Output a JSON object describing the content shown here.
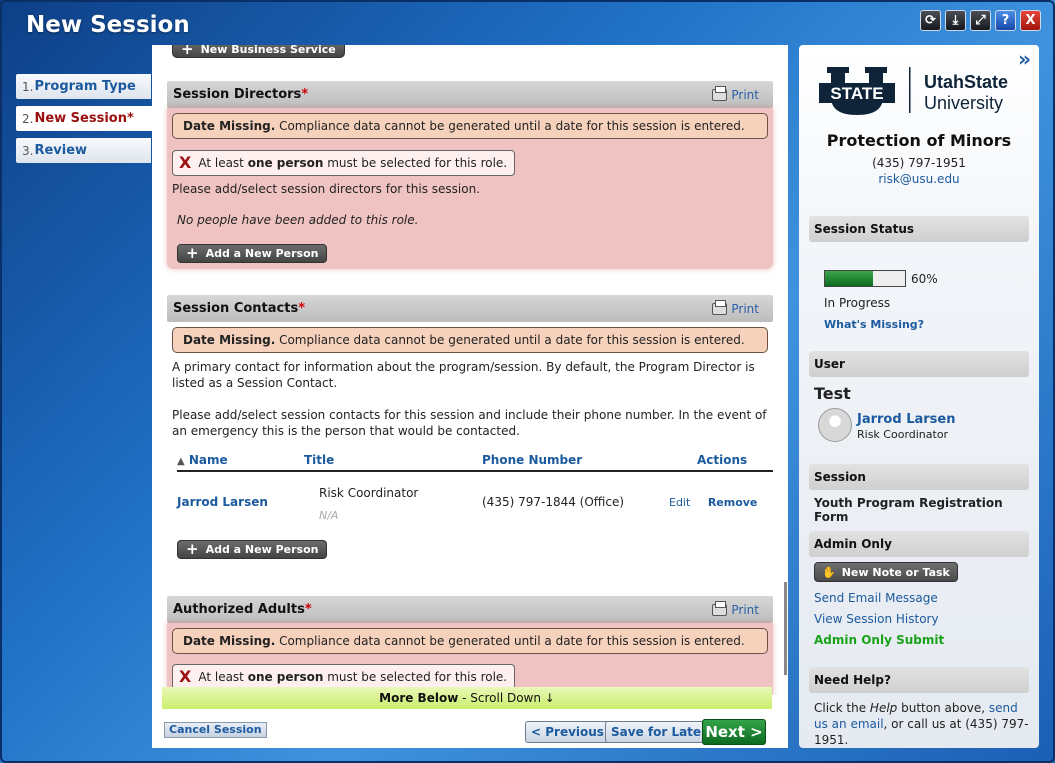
{
  "app": {
    "title": "New Session"
  },
  "window_controls": [
    {
      "name": "refresh-icon",
      "glyph": "⟳"
    },
    {
      "name": "download-icon",
      "glyph": "⤓"
    },
    {
      "name": "expand-icon",
      "glyph": "⤢"
    },
    {
      "name": "help-icon",
      "glyph": "?"
    },
    {
      "name": "close-icon",
      "glyph": "X"
    }
  ],
  "steps": [
    {
      "num": "1.",
      "label": "Program Type"
    },
    {
      "num": "2.",
      "label": "New Session*"
    },
    {
      "num": "3.",
      "label": "Review"
    }
  ],
  "top_button": "New Business Service",
  "date_missing": {
    "bold": "Date Missing.",
    "text": " Compliance data cannot be generated until a date for this session is entered."
  },
  "error": {
    "pre": "At least ",
    "bold": "one person",
    "post": " must be selected for this role."
  },
  "print_label": "Print",
  "add_person_label": "Add a New Person",
  "directors": {
    "title": "Session Directors",
    "req": "*",
    "instruction": "Please add/select session directors for this session.",
    "empty": "No people have been added to this role."
  },
  "contacts": {
    "title": "Session Contacts",
    "req": "*",
    "desc1": "A primary contact for information about the program/session.  By default, the Program Director is listed as a Session Contact.",
    "desc2": "Please add/select session contacts for this session and include their phone number. In the event of an emergency this is the person that would be contacted.",
    "columns": {
      "name": "Name",
      "title": "Title",
      "phone": "Phone Number",
      "actions": "Actions"
    },
    "rows": [
      {
        "name": "Jarrod Larsen",
        "title": "Risk Coordinator",
        "title2": "N/A",
        "phone": "(435) 797-1844 (Office)",
        "edit": "Edit",
        "remove": "Remove"
      }
    ]
  },
  "adults": {
    "title": "Authorized Adults",
    "req": "*"
  },
  "more_below": {
    "bold": "More Below",
    "text": " - Scroll Down ↓"
  },
  "footer": {
    "cancel": "Cancel Session",
    "previous": "< Previous",
    "save": "Save for Later",
    "next": "Next >"
  },
  "sidebar": {
    "collapse": "»",
    "logo": {
      "word1": "STATE",
      "word2": "UtahState",
      "word3": "University",
      "u": "U"
    },
    "org_title": "Protection of Minors",
    "phone": "(435) 797-1951",
    "email": "risk@usu.edu",
    "status_head": "Session Status",
    "progress_value": 0.6,
    "progress_label": "60%",
    "status_text": "In Progress",
    "whats_missing": "What's Missing?",
    "user_head": "User",
    "user_test": "Test",
    "user_name": "Jarrod Larsen",
    "user_role": "Risk Coordinator",
    "session_head": "Session",
    "session_name": "Youth Program Registration Form",
    "admin_head": "Admin Only",
    "note_btn": "New Note or Task",
    "send_email": "Send Email Message",
    "view_history": "View Session History",
    "admin_submit": "Admin Only Submit",
    "help_head": "Need Help?",
    "help_text1": "Click the ",
    "help_italic": "Help",
    "help_text2": " button above, ",
    "help_link": "send us an email",
    "help_text3": ", or call us at (435) 797-1951."
  },
  "colors": {
    "accent": "#1b5a9e",
    "error": "#9c1010",
    "success": "#0d6b1f",
    "pink": "#f0c3c3"
  }
}
